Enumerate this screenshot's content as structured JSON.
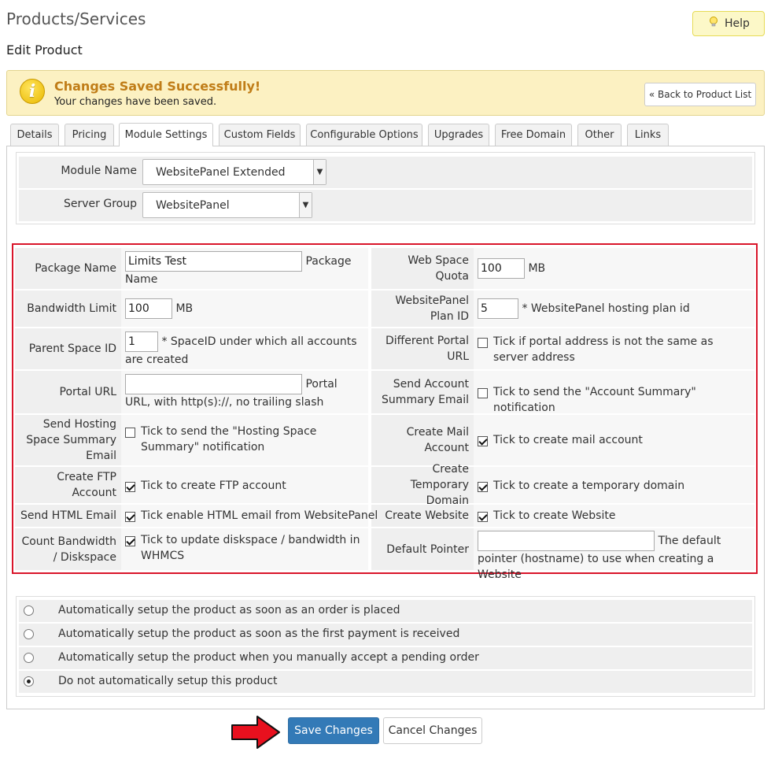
{
  "header": {
    "title": "Products/Services",
    "subtitle": "Edit Product",
    "help_label": "Help"
  },
  "alert": {
    "title": "Changes Saved Successfully!",
    "message": "Your changes have been saved.",
    "back_label": "« Back to Product List",
    "icon": "info-icon",
    "title_color": "#c07d18"
  },
  "tabs": [
    {
      "label": "Details"
    },
    {
      "label": "Pricing"
    },
    {
      "label": "Module Settings"
    },
    {
      "label": "Custom Fields"
    },
    {
      "label": "Configurable Options"
    },
    {
      "label": "Upgrades"
    },
    {
      "label": "Free Domain"
    },
    {
      "label": "Other"
    },
    {
      "label": "Links"
    }
  ],
  "active_tab": "Module Settings",
  "module": {
    "module_name_label": "Module Name",
    "module_name_value": "WebsitePanel Extended",
    "server_group_label": "Server Group",
    "server_group_value": "WebsitePanel"
  },
  "settings": {
    "package_name": {
      "label": "Package Name",
      "value": "Limits Test",
      "help": "Package Name"
    },
    "web_space_quota": {
      "label": "Web Space Quota",
      "value": "100",
      "help": "MB"
    },
    "bandwidth_limit": {
      "label": "Bandwidth Limit",
      "value": "100",
      "help": "MB"
    },
    "plan_id": {
      "label": "WebsitePanel Plan ID",
      "value": "5",
      "help": "* WebsitePanel hosting plan id"
    },
    "parent_space_id": {
      "label": "Parent Space ID",
      "value": "1",
      "help": "* SpaceID under which all accounts are created"
    },
    "different_portal_url": {
      "label": "Different Portal URL",
      "checked": false,
      "help": "Tick if portal address is not the same as server address"
    },
    "portal_url": {
      "label": "Portal URL",
      "value": "",
      "help": "Portal URL, with http(s)://, no trailing slash"
    },
    "send_account_summary": {
      "label": "Send Account Summary Email",
      "checked": false,
      "help": "Tick to send the \"Account Summary\" notification"
    },
    "send_hosting_summary": {
      "label": "Send Hosting Space Summary Email",
      "checked": false,
      "help": "Tick to send the \"Hosting Space Summary\" notification"
    },
    "create_mail_account": {
      "label": "Create Mail Account",
      "checked": true,
      "help": "Tick to create mail account"
    },
    "create_ftp_account": {
      "label": "Create FTP Account",
      "checked": true,
      "help": "Tick to create FTP account"
    },
    "create_temp_domain": {
      "label": "Create Temporary Domain",
      "checked": true,
      "help": "Tick to create a temporary domain"
    },
    "send_html_email": {
      "label": "Send HTML Email",
      "checked": true,
      "help": "Tick enable HTML email from WebsitePanel"
    },
    "create_website": {
      "label": "Create Website",
      "checked": true,
      "help": "Tick to create Website"
    },
    "count_bandwidth": {
      "label": "Count Bandwidth / Diskspace",
      "checked": true,
      "help": "Tick to update diskspace / bandwidth in WHMCS"
    },
    "default_pointer": {
      "label": "Default Pointer",
      "value": "",
      "help": "The default pointer (hostname) to use when creating a Website"
    }
  },
  "setup_options": [
    {
      "label": "Automatically setup the product as soon as an order is placed",
      "selected": false
    },
    {
      "label": "Automatically setup the product as soon as the first payment is received",
      "selected": false
    },
    {
      "label": "Automatically setup the product when you manually accept a pending order",
      "selected": false
    },
    {
      "label": "Do not automatically setup this product",
      "selected": true
    }
  ],
  "actions": {
    "save_label": "Save Changes",
    "cancel_label": "Cancel Changes",
    "save_color": "#337ab7"
  },
  "colors": {
    "highlight_border": "#d9152a",
    "row_bg": "#efefef"
  }
}
